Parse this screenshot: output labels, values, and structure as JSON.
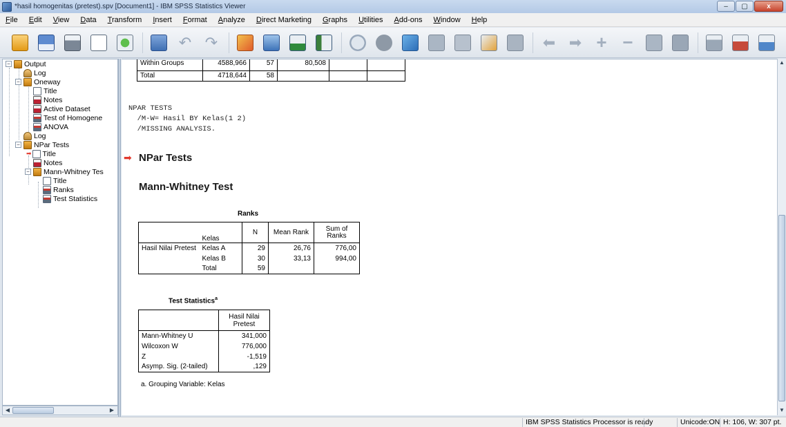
{
  "window": {
    "title": "*hasil homogenitas (pretest).spv [Document1] - IBM SPSS Statistics Viewer",
    "minimize": "–",
    "restore": "▢",
    "close": "x"
  },
  "menu": [
    "File",
    "Edit",
    "View",
    "Data",
    "Transform",
    "Insert",
    "Format",
    "Analyze",
    "Direct Marketing",
    "Graphs",
    "Utilities",
    "Add-ons",
    "Window",
    "Help"
  ],
  "toolbar": {
    "icons": [
      "open-icon",
      "save-icon",
      "print-icon",
      "print-preview-icon",
      "export-icon",
      "recall-dialog-icon",
      "undo-icon",
      "redo-icon",
      "goto-data-icon",
      "goto-case-icon",
      "goto-variable-icon",
      "variables-icon",
      "chart-icon",
      "pie-icon",
      "filter-icon",
      "designate-window-icon",
      "select-last-output-icon",
      "create-edit-icon",
      "autoscript-icon",
      "back-icon",
      "forward-icon",
      "expand-icon",
      "collapse-icon",
      "show-icon",
      "hide-icon",
      "insert-heading-icon",
      "insert-title-icon",
      "insert-text-icon"
    ]
  },
  "outline": {
    "items": [
      {
        "label": "Output",
        "icon": "output-book-icon"
      },
      {
        "label": "Log",
        "icon": "log-icon"
      },
      {
        "label": "Oneway",
        "icon": "book-icon"
      },
      {
        "label": "Title",
        "icon": "title-icon"
      },
      {
        "label": "Notes",
        "icon": "notes-icon"
      },
      {
        "label": "Active Dataset",
        "icon": "notes-icon"
      },
      {
        "label": "Test of Homogene",
        "icon": "table-icon"
      },
      {
        "label": "ANOVA",
        "icon": "table-icon"
      },
      {
        "label": "Log",
        "icon": "log-icon"
      },
      {
        "label": "NPar Tests",
        "icon": "book-icon"
      },
      {
        "label": "Title",
        "icon": "title-icon"
      },
      {
        "label": "Notes",
        "icon": "notes-icon"
      },
      {
        "label": "Mann-Whitney Tes",
        "icon": "book-icon"
      },
      {
        "label": "Title",
        "icon": "title-icon"
      },
      {
        "label": "Ranks",
        "icon": "table-icon"
      },
      {
        "label": "Test Statistics",
        "icon": "table-icon"
      }
    ]
  },
  "anova_partial": {
    "rows": [
      {
        "label": "Within Groups",
        "ss": "4588,966",
        "df": "57",
        "ms": "80,508"
      },
      {
        "label": "Total",
        "ss": "4718,644",
        "df": "58",
        "ms": ""
      }
    ]
  },
  "syntax": {
    "line1": "NPAR TESTS",
    "line2": "  /M-W= Hasil BY Kelas(1 2)",
    "line3": "  /MISSING ANALYSIS."
  },
  "headings": {
    "npar": "NPar Tests",
    "mann_whitney": "Mann-Whitney Test"
  },
  "ranks_table": {
    "caption": "Ranks",
    "headers": {
      "kelas": "Kelas",
      "n": "N",
      "mean_rank": "Mean Rank",
      "sum_of_ranks_1": "Sum of",
      "sum_of_ranks_2": "Ranks"
    },
    "row_label": "Hasil Nilai Pretest",
    "rows": [
      {
        "kelas": "Kelas A",
        "n": "29",
        "mean_rank": "26,76",
        "sum": "776,00"
      },
      {
        "kelas": "Kelas B",
        "n": "30",
        "mean_rank": "33,13",
        "sum": "994,00"
      },
      {
        "kelas": "Total",
        "n": "59",
        "mean_rank": "",
        "sum": ""
      }
    ]
  },
  "test_stats_table": {
    "caption": "Test Statistics",
    "caption_sup": "a",
    "header_1": "Hasil Nilai",
    "header_2": "Pretest",
    "rows": [
      {
        "label": "Mann-Whitney U",
        "value": "341,000"
      },
      {
        "label": "Wilcoxon W",
        "value": "776,000"
      },
      {
        "label": "Z",
        "value": "-1,519"
      },
      {
        "label": "Asymp. Sig. (2-tailed)",
        "value": ",129"
      }
    ],
    "footnote": "a. Grouping Variable: Kelas"
  },
  "status": {
    "processor": "IBM SPSS Statistics Processor is ready",
    "unicode": "Unicode:ON",
    "dims": "H: 106, W: 307 pt."
  },
  "colors": {
    "selection_arrow": "#e23a2e",
    "title_bar": "#c2d5ec"
  }
}
